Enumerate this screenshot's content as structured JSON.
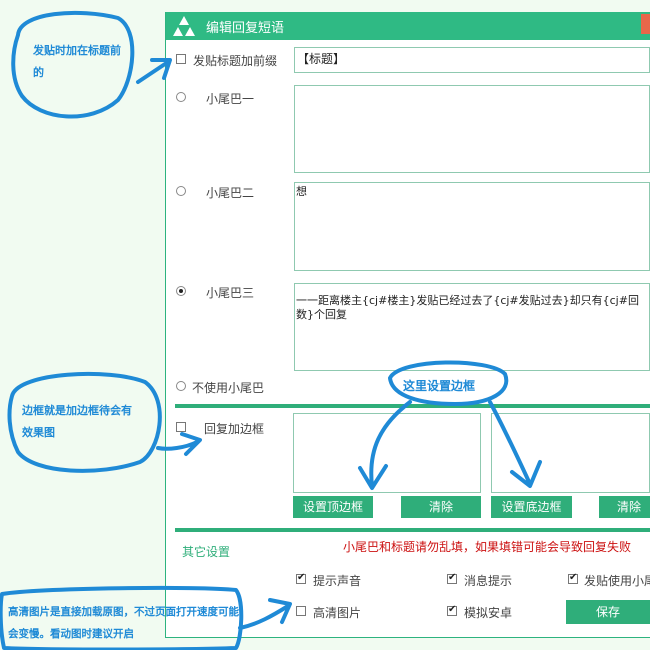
{
  "window": {
    "title": "编辑回复短语"
  },
  "title_prefix": {
    "label": "发贴标题加前缀",
    "checked": false,
    "value": "【标题】"
  },
  "tails": [
    {
      "label": "小尾巴一",
      "selected": false,
      "text": ""
    },
    {
      "label": "小尾巴二",
      "selected": false,
      "text": "想"
    },
    {
      "label": "小尾巴三",
      "selected": true,
      "text": "一一距离楼主{cj#楼主}发贴已经过去了{cj#发贴过去}却只有{cj#回数}个回复"
    }
  ],
  "no_tail": {
    "label": "不使用小尾巴",
    "selected": false
  },
  "border": {
    "label": "回复加边框",
    "checked": false,
    "set_top_label": "设置顶边框",
    "clear_label": "清除",
    "set_bottom_label": "设置底边框",
    "clear2_label": "清除",
    "hint": "这里设置边框"
  },
  "other": {
    "heading": "其它设置",
    "warning": "小尾巴和标题请勿乱填，如果填错可能会导致回复失败",
    "options": [
      {
        "label": "提示声音",
        "checked": true
      },
      {
        "label": "消息提示",
        "checked": true
      },
      {
        "label": "发贴使用小尾",
        "checked": true
      },
      {
        "label": "高清图片",
        "checked": false
      },
      {
        "label": "模拟安卓",
        "checked": true
      }
    ],
    "save_label": "保存"
  },
  "annotations": {
    "a1": "发贴时加在标题前的",
    "a2": "边框就是加边框待会有效果图",
    "a3": "高清图片是直接加载原图，不过页面打开速度可能会变慢。看动图时建议开启"
  },
  "colors": {
    "accent": "#2fba84",
    "annotation": "#1f8ad6",
    "warning": "#cc1111"
  }
}
